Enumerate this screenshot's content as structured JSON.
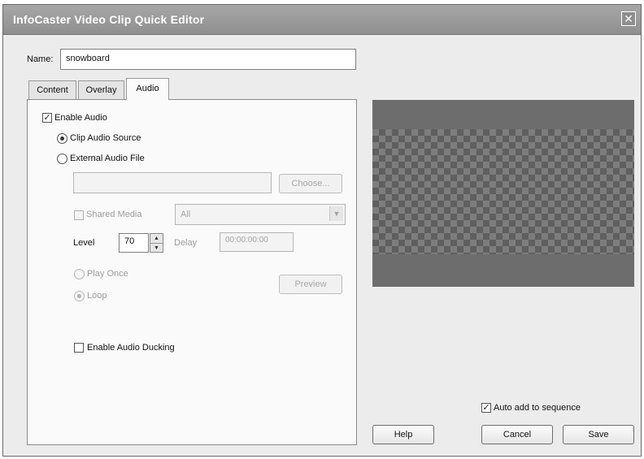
{
  "window": {
    "title": "InfoCaster Video Clip Quick Editor",
    "close_glyph": "✕"
  },
  "name_field": {
    "label": "Name:",
    "value": "snowboard"
  },
  "tabs": [
    {
      "label": "Content"
    },
    {
      "label": "Overlay"
    },
    {
      "label": "Audio",
      "active": true
    }
  ],
  "audio": {
    "enable_audio": {
      "label": "Enable Audio",
      "checked": true
    },
    "clip_audio_source": {
      "label": "Clip Audio Source",
      "selected": true
    },
    "external_audio_file": {
      "label": "External Audio File",
      "selected": false
    },
    "file_path_value": "",
    "choose_button": "Choose...",
    "shared_media": {
      "label": "Shared Media",
      "checked": false
    },
    "media_filter": {
      "value": "All"
    },
    "level": {
      "label": "Level",
      "value": "70"
    },
    "delay": {
      "label": "Delay",
      "value": "00:00:00:00"
    },
    "play_once": {
      "label": "Play Once",
      "selected": false
    },
    "loop": {
      "label": "Loop",
      "selected": true
    },
    "preview_button": "Preview",
    "enable_audio_ducking": {
      "label": "Enable Audio Ducking",
      "checked": false
    }
  },
  "auto_add": {
    "label": "Auto add to sequence",
    "checked": true
  },
  "buttons": {
    "help": "Help",
    "cancel": "Cancel",
    "save": "Save"
  },
  "icons": {
    "checkmark": "✓",
    "spin_up": "▲",
    "spin_down": "▼",
    "dropdown": "▼"
  },
  "colors": {
    "titlebar": "#999999",
    "dialog_bg": "#ececec",
    "preview_bg": "#6d6d6d"
  }
}
